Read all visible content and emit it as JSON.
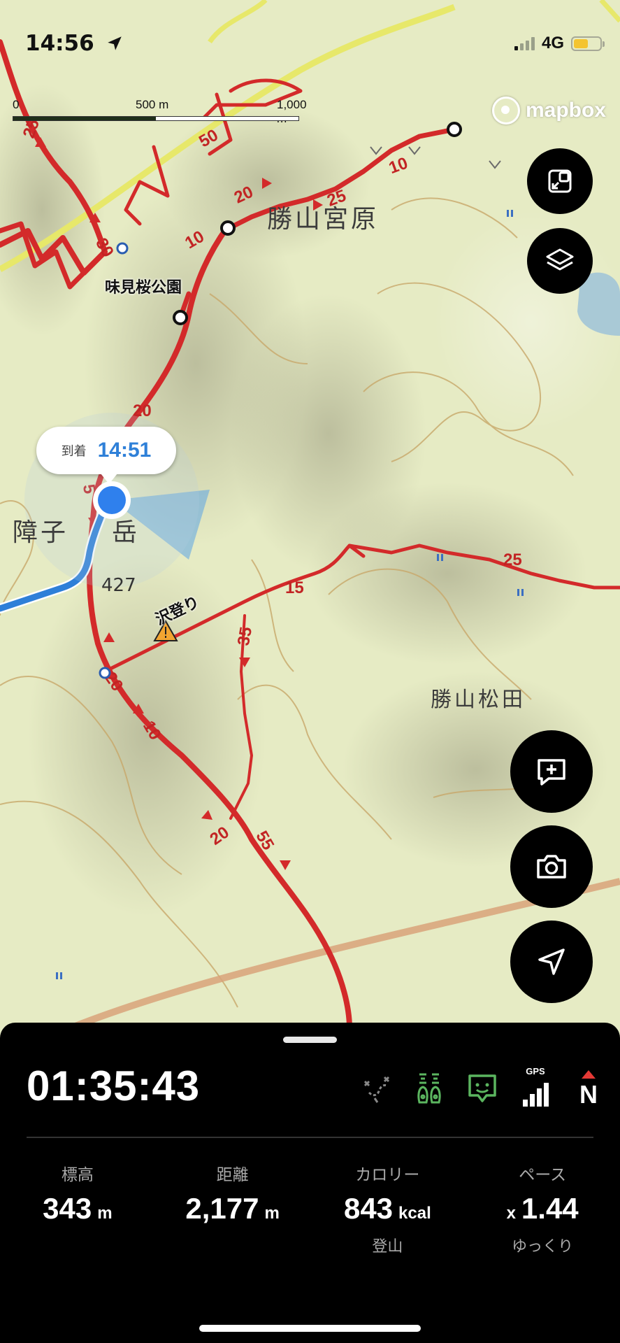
{
  "status": {
    "time": "14:56",
    "network": "4G"
  },
  "map": {
    "scale": {
      "start": "0",
      "mid": "500 m",
      "end": "1,000 m"
    },
    "attribution": "mapbox",
    "place_labels": [
      "勝山宮原",
      "障子",
      "岳",
      "勝山松田"
    ],
    "poi_label": "味見桜公園",
    "hazard_label": "沢登り",
    "elevation_label": "427",
    "route_numbers": [
      "25",
      "50",
      "30",
      "20",
      "10",
      "25",
      "10",
      "20",
      "5",
      "20",
      "10",
      "20",
      "55",
      "35",
      "15",
      "25"
    ],
    "eta": {
      "label": "到着",
      "time": "14:51"
    },
    "colors": {
      "route": "#d32a2a",
      "track": "#2e7fd8",
      "location": "#2f80ed"
    }
  },
  "buttons": {
    "expand": "expand-icon",
    "layers": "layers-icon",
    "add_memo": "add-note-icon",
    "camera": "camera-icon",
    "locate": "location-arrow-icon"
  },
  "panel": {
    "timer": "01:35:43",
    "status_icons": {
      "gps": "GPS",
      "compass": "N"
    },
    "stats": [
      {
        "label": "標高",
        "value": "343",
        "unit": "m",
        "sub": ""
      },
      {
        "label": "距離",
        "value": "2,177",
        "unit": "m",
        "sub": ""
      },
      {
        "label": "カロリー",
        "value": "843",
        "unit": "kcal",
        "sub": "登山"
      },
      {
        "label": "ペース",
        "prefix": "x",
        "value": "1.44",
        "unit": "",
        "sub": "ゆっくり"
      }
    ]
  }
}
